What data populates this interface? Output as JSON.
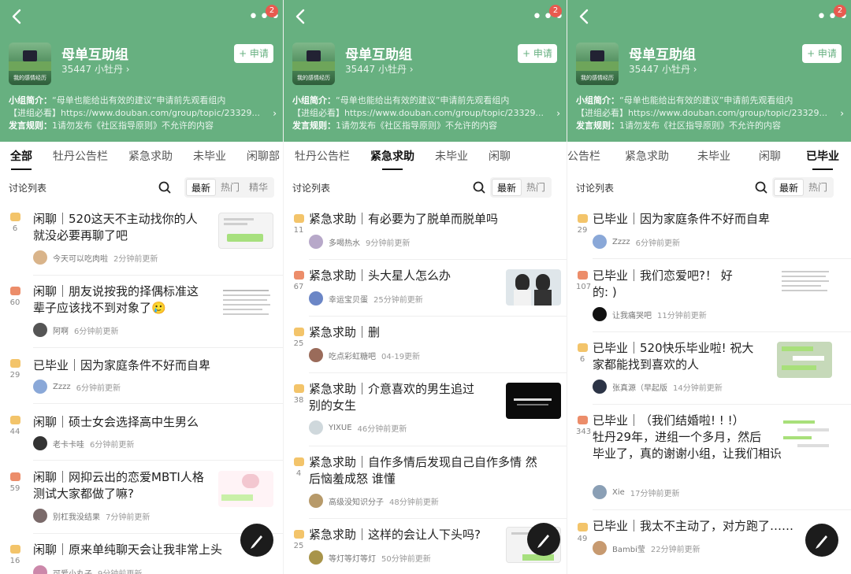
{
  "header": {
    "group_name": "母单互助组",
    "member_count": "35447 小牡丹 ›",
    "apply_label": "+ 申请",
    "group_image_caption": "我的感情经历",
    "badge": "2",
    "intro_label": "小组简介：",
    "intro_text": "“母单也能给出有效的建议”申请前先观看组内",
    "intro_link": "【进组必看】https://www.douban.com/group/topic/23329...",
    "rule_label": "发言规则：",
    "rule_text": "1请勿发布《社区指导原则》不允许的内容"
  },
  "list_title": "讨论列表",
  "sort_options": [
    "最新",
    "热门",
    "精华"
  ],
  "panels": [
    {
      "tabs": [
        "全部",
        "牡丹公告栏",
        "紧急求助",
        "未毕业",
        "闲聊"
      ],
      "active_tab": 0,
      "items": [
        {
          "title": "闲聊｜520这天不主动找你的人就没必要再聊了吧",
          "line1": "闲聊｜520这天不主动找你的人",
          "line2": "就没必要再聊了吧",
          "comments": "6",
          "user": "今天可以吃肉啦",
          "time": "2分钟前更新"
        },
        {
          "title": "闲聊｜朋友说按我的择偶标准这辈子应该找不到对象了",
          "line1": "闲聊｜朋友说按我的择偶标准这",
          "line2": "辈子应该找不到对象了🥲",
          "comments": "60",
          "user": "阿啊",
          "time": "6分钟前更新"
        },
        {
          "title": "已毕业｜因为家庭条件不好而自卑",
          "line1": "已毕业｜因为家庭条件不好而自卑",
          "line2": "",
          "comments": "29",
          "user": "Zzzz",
          "time": "6分钟前更新"
        },
        {
          "title": "闲聊｜硕士女会选择高中生男么",
          "line1": "闲聊｜硕士女会选择高中生男么",
          "line2": "",
          "comments": "44",
          "user": "老卡卡哇",
          "time": "6分钟前更新"
        },
        {
          "title": "闲聊｜网抑云出的恋爱MBTI人格测试大家都做了嘛?",
          "line1": "闲聊｜网抑云出的恋爱MBTI人格",
          "line2": "测试大家都做了嘛?",
          "comments": "59",
          "user": "别杠我没结果",
          "time": "7分钟前更新"
        },
        {
          "title": "闲聊｜原来单纯聊天会让我非常上头",
          "line1": "闲聊｜原来单纯聊天会让我非常上头",
          "line2": "",
          "comments": "16",
          "user": "可爱小丸子",
          "time": "9分钟前更新"
        }
      ]
    },
    {
      "tabs": [
        "闲聊",
        "牡丹公告栏",
        "紧急求助",
        "未毕业",
        "闲聊"
      ],
      "active_tab": 2,
      "items": [
        {
          "line1": "紧急求助｜有必要为了脱单而脱单吗",
          "line2": "",
          "comments": "11",
          "user": "多喝热水",
          "time": "9分钟前更新"
        },
        {
          "line1": "紧急求助｜头大星人怎么办",
          "line2": "",
          "comments": "67",
          "user": "幸运宝贝蛋",
          "time": "25分钟前更新"
        },
        {
          "line1": "紧急求助｜删",
          "line2": "",
          "comments": "25",
          "user": "吃点彩虹糖吧",
          "time": "04-19更新"
        },
        {
          "line1": "紧急求助｜介意喜欢的男生追过",
          "line2": "别的女生",
          "comments": "38",
          "user": "YIXUE",
          "time": "46分钟前更新"
        },
        {
          "line1": "紧急求助｜自作多情后发现自己自作多情 然",
          "line2": "后恼羞成怒 谁懂",
          "comments": "4",
          "user": "高级没知识分子",
          "time": "48分钟前更新"
        },
        {
          "line1": "紧急求助｜这样的会让人下头吗?",
          "line2": "",
          "comments": "25",
          "user": "等灯等灯等灯",
          "time": "50分钟前更新"
        }
      ]
    },
    {
      "tabs": [
        "公告栏",
        "紧急求助",
        "未毕业",
        "闲聊",
        "已毕业"
      ],
      "active_tab": 4,
      "items": [
        {
          "line1": "已毕业｜因为家庭条件不好而自卑",
          "line2": "",
          "line3": "",
          "comments": "29",
          "user": "Zzzz",
          "time": "6分钟前更新"
        },
        {
          "line1": "已毕业｜我们恋爱吧?！ 好",
          "line2": "的: )",
          "line3": "",
          "comments": "107",
          "user": "让我痛哭吧",
          "time": "11分钟前更新"
        },
        {
          "line1": "已毕业｜520快乐毕业啦! 祝大",
          "line2": "家都能找到喜欢的人",
          "line3": "",
          "comments": "6",
          "user": "张真源（早起版",
          "time": "14分钟前更新"
        },
        {
          "line1": "已毕业｜（我们结婚啦! ! !）",
          "line2": "牡丹29年，进组一个多月，然后",
          "line3": "毕业了，真的谢谢小组，让我们相识",
          "comments": "343",
          "user": "Xie",
          "time": "17分钟前更新"
        },
        {
          "line1": "已毕业｜我太不主动了，对方跑了……",
          "line2": "",
          "line3": "",
          "comments": "49",
          "user": "Bambi莹",
          "time": "22分钟前更新"
        }
      ]
    }
  ],
  "panel1_tab_tail": "闲聊部",
  "panel2_tab_head": "闲聊",
  "colors": {
    "header_green": "#67b080",
    "badge_red": "#e85a4f",
    "comment_yellow": "#f3c46a",
    "comment_red": "#ec8d6a"
  }
}
